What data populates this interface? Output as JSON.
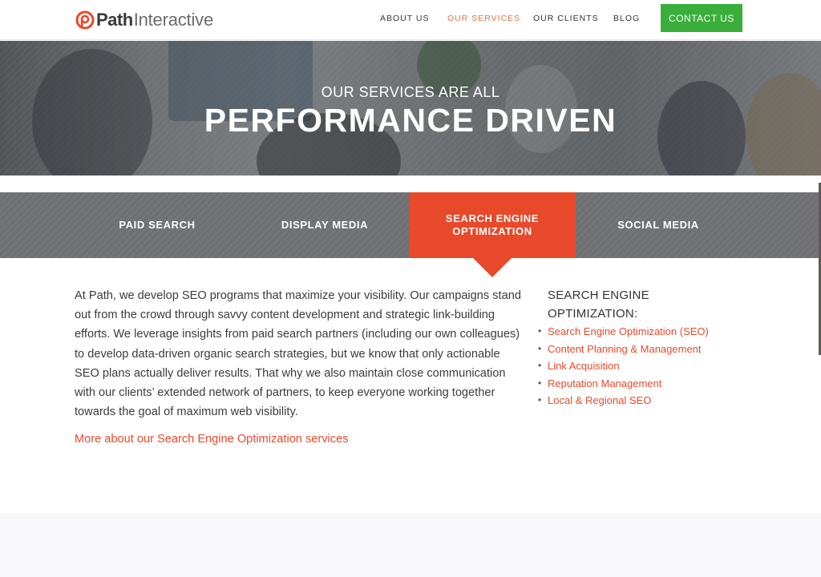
{
  "header": {
    "logo": {
      "word1": "Path",
      "word2": "Interactive"
    },
    "nav": [
      {
        "label": "ABOUT US",
        "active": false
      },
      {
        "label": "OUR SERVICES",
        "active": true
      },
      {
        "label": "OUR CLIENTS",
        "active": false
      },
      {
        "label": "BLOG",
        "active": false
      }
    ],
    "contact_label": "CONTACT US"
  },
  "hero": {
    "eyebrow": "OUR SERVICES ARE ALL",
    "title": "PERFORMANCE DRIVEN"
  },
  "tabs": [
    {
      "line1": "PAID SEARCH",
      "line2": "",
      "active": false
    },
    {
      "line1": "DISPLAY MEDIA",
      "line2": "",
      "active": false
    },
    {
      "line1": "SEARCH ENGINE",
      "line2": "OPTIMIZATION",
      "active": true
    },
    {
      "line1": "SOCIAL MEDIA",
      "line2": "",
      "active": false
    }
  ],
  "content": {
    "body": "At Path, we develop SEO programs that maximize your visibility. Our campaigns stand out from the crowd through savvy content development and strategic link-building efforts. We leverage insights from paid search partners (including our own colleagues) to develop data-driven organic search strategies, but we know that only actionable SEO plans actually deliver results. That why we also maintain close communication with our clients’ extended network of partners, to keep everyone working together towards the goal of maximum web visibility.",
    "more_link": "More about our Search Engine Optimization services"
  },
  "sidebar": {
    "heading": "SEARCH ENGINE OPTIMIZATION:",
    "items": [
      {
        "label": "Search Engine Optimization (SEO)"
      },
      {
        "label": "Content Planning & Management"
      },
      {
        "label": "Link Acquisition"
      },
      {
        "label": "Reputation Management"
      },
      {
        "label": "Local & Regional SEO"
      }
    ]
  },
  "colors": {
    "accent": "#e8492a",
    "nav_active": "#e8743b",
    "contact_green": "#3aae3a",
    "tab_bg": "#6e6f72"
  },
  "icons": {
    "logo": "path-p-logo-icon"
  }
}
